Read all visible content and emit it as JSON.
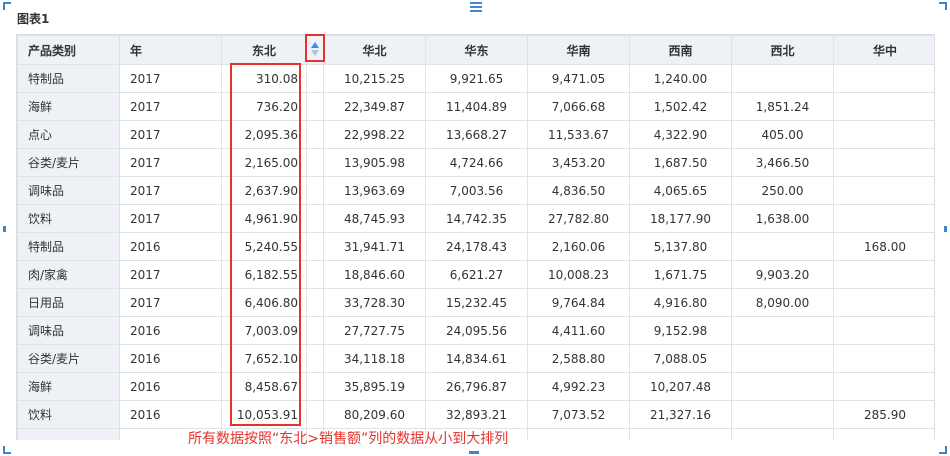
{
  "widget": {
    "title": "图表1"
  },
  "table": {
    "headers": [
      "产品类别",
      "年",
      "东北",
      "",
      "华北",
      "华东",
      "华南",
      "西南",
      "西北",
      "华中"
    ],
    "rows": [
      [
        "特制品",
        "2017",
        "310.08",
        "10,215.25",
        "9,921.65",
        "9,471.05",
        "1,240.00",
        "",
        ""
      ],
      [
        "海鲜",
        "2017",
        "736.20",
        "22,349.87",
        "11,404.89",
        "7,066.68",
        "1,502.42",
        "1,851.24",
        ""
      ],
      [
        "点心",
        "2017",
        "2,095.36",
        "22,998.22",
        "13,668.27",
        "11,533.67",
        "4,322.90",
        "405.00",
        ""
      ],
      [
        "谷类/麦片",
        "2017",
        "2,165.00",
        "13,905.98",
        "4,724.66",
        "3,453.20",
        "1,687.50",
        "3,466.50",
        ""
      ],
      [
        "调味品",
        "2017",
        "2,637.90",
        "13,963.69",
        "7,003.56",
        "4,836.50",
        "4,065.65",
        "250.00",
        ""
      ],
      [
        "饮料",
        "2017",
        "4,961.90",
        "48,745.93",
        "14,742.35",
        "27,782.80",
        "18,177.90",
        "1,638.00",
        ""
      ],
      [
        "特制品",
        "2016",
        "5,240.55",
        "31,941.71",
        "24,178.43",
        "2,160.06",
        "5,137.80",
        "",
        "168.00"
      ],
      [
        "肉/家禽",
        "2017",
        "6,182.55",
        "18,846.60",
        "6,621.27",
        "10,008.23",
        "1,671.75",
        "9,903.20",
        ""
      ],
      [
        "日用品",
        "2017",
        "6,406.80",
        "33,728.30",
        "15,232.45",
        "9,764.84",
        "4,916.80",
        "8,090.00",
        ""
      ],
      [
        "调味品",
        "2016",
        "7,003.09",
        "27,727.75",
        "24,095.56",
        "4,411.60",
        "9,152.98",
        "",
        ""
      ],
      [
        "谷类/麦片",
        "2016",
        "7,652.10",
        "34,118.18",
        "14,834.61",
        "2,588.80",
        "7,088.05",
        "",
        ""
      ],
      [
        "海鲜",
        "2016",
        "8,458.67",
        "35,895.19",
        "26,796.87",
        "4,992.23",
        "10,207.48",
        "",
        ""
      ],
      [
        "饮料",
        "2016",
        "10,053.91",
        "80,209.60",
        "32,893.21",
        "7,073.52",
        "21,327.16",
        "",
        "285.90"
      ]
    ],
    "sorted_column": "东北",
    "sort_direction": "ascending"
  },
  "annotation": {
    "text": "所有数据按照“东北>销售额”列的数据从小到大排列"
  },
  "colors": {
    "header_bg": "#eef2f6",
    "grid": "#dfe3e8",
    "highlight": "#e5322b",
    "accent": "#3d86c6"
  },
  "icons": [
    "sort-asc-icon",
    "drag-handle-icon"
  ]
}
